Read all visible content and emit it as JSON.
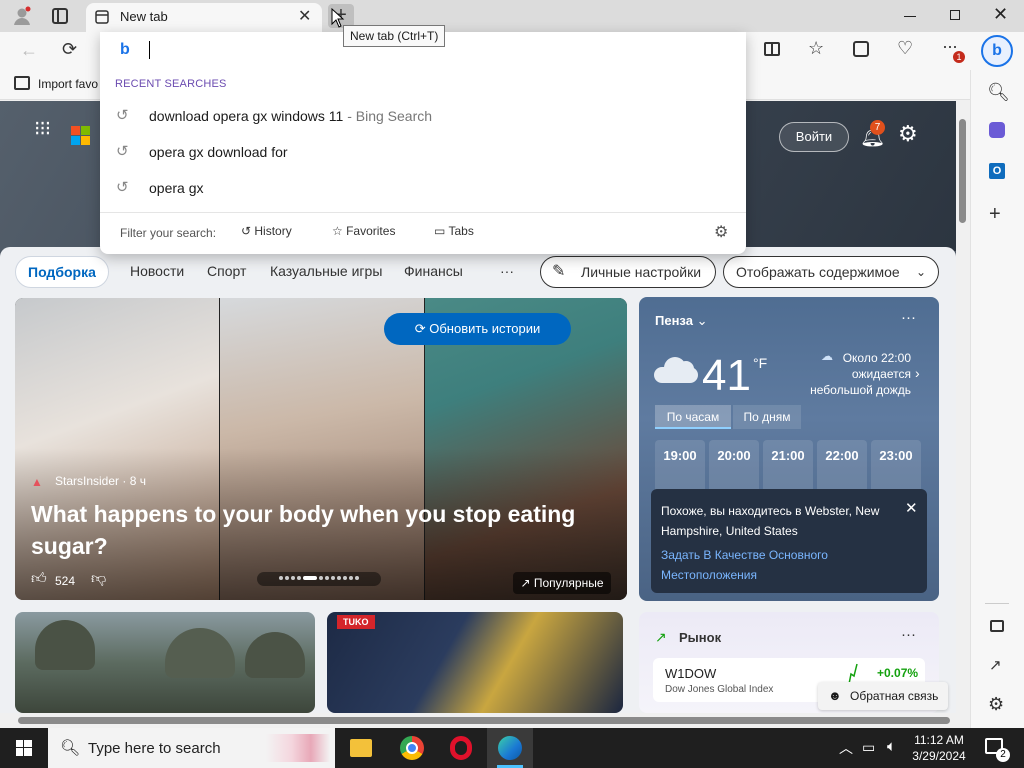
{
  "browser": {
    "tab_title": "New tab",
    "new_tab_tooltip": "New tab (Ctrl+T)",
    "favorites_item": "Import favo",
    "notification_badge": "1"
  },
  "omnibox": {
    "section_title": "RECENT SEARCHES",
    "suggestions": [
      {
        "query": "download opera gx windows 11",
        "suffix": " - Bing Search"
      },
      {
        "query": "opera gx download for",
        "suffix": ""
      },
      {
        "query": "opera gx",
        "suffix": ""
      }
    ],
    "filter_label": "Filter your search:",
    "filters": [
      "History",
      "Favorites",
      "Tabs"
    ]
  },
  "newtab": {
    "signin": "Войти",
    "bell_badge": "7",
    "feed_tabs": [
      "Подборка",
      "Новости",
      "Спорт",
      "Казуальные игры",
      "Финансы"
    ],
    "more": "···",
    "personalize": "Личные настройки",
    "show_content": "Отображать содержимое",
    "refresh": "Обновить истории",
    "hero": {
      "source": "StarsInsider",
      "age": " · 8 ч",
      "title": "What happens to your body when you stop eating sugar?",
      "likes": "524",
      "popular": "Популярные"
    },
    "weather": {
      "city": "Пенза",
      "temp": "41",
      "unit": "°F",
      "forecast_line1": "Около 22:00",
      "forecast_line2": "ожидается",
      "forecast_line3": "небольшой дождь",
      "tab_hourly": "По часам",
      "tab_daily": "По дням",
      "hours": [
        "19:00",
        "20:00",
        "21:00",
        "22:00",
        "23:00"
      ],
      "location_msg": "Похоже, вы находитесь в Webster, New Hampshire, United States",
      "location_link": "Задать В Качестве Основного Местоположения"
    },
    "market": {
      "title": "Рынок",
      "ticker": "W1DOW",
      "change": "+0.07%",
      "index_name": "Dow Jones Global Index"
    },
    "small_card_badge": "TUKO",
    "feedback": "Обратная связь"
  },
  "taskbar": {
    "search_placeholder": "Type here to search",
    "time": "11:12 AM",
    "date": "3/29/2024",
    "notif_count": "2"
  },
  "colors": {
    "accent": "#0067c0",
    "link": "#7ab6ff"
  }
}
